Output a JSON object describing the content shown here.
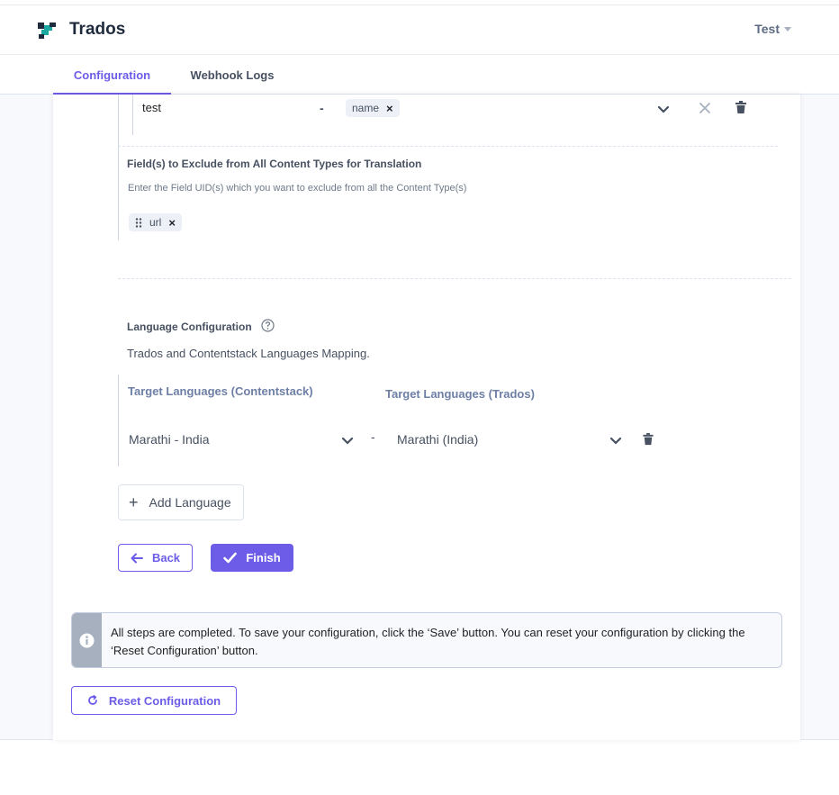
{
  "header": {
    "app_title": "Trados",
    "user_name": "Test"
  },
  "tabs": [
    {
      "label": "Configuration",
      "active": true
    },
    {
      "label": "Webhook Logs",
      "active": false
    }
  ],
  "field_mapping_row": {
    "content_type": "test",
    "separator": "-",
    "fields": [
      "name"
    ]
  },
  "exclude_fields": {
    "title": "Field(s) to Exclude from All Content Types for Translation",
    "help": "Enter the Field UID(s) which you want to exclude from all the Content Type(s)",
    "tags": [
      "url"
    ]
  },
  "language_config": {
    "title": "Language Configuration",
    "description": "Trados and Contentstack Languages Mapping.",
    "col_contentstack": "Target Languages (Contentstack)",
    "col_trados": "Target Languages (Trados)",
    "rows": [
      {
        "contentstack": "Marathi - India",
        "separator": "-",
        "trados": "Marathi (India)"
      }
    ],
    "add_label": "Add Language"
  },
  "actions": {
    "back_label": "Back",
    "finish_label": "Finish"
  },
  "notice": {
    "text": "All steps are completed. To save your configuration, click the ‘Save’ button. You can reset your configuration by clicking the ‘Reset Configuration’ button."
  },
  "reset": {
    "label": "Reset Configuration"
  },
  "colors": {
    "accent": "#6c5ce7",
    "logo_teal": "#1aa9a0",
    "logo_dark": "#1f2b3d"
  }
}
